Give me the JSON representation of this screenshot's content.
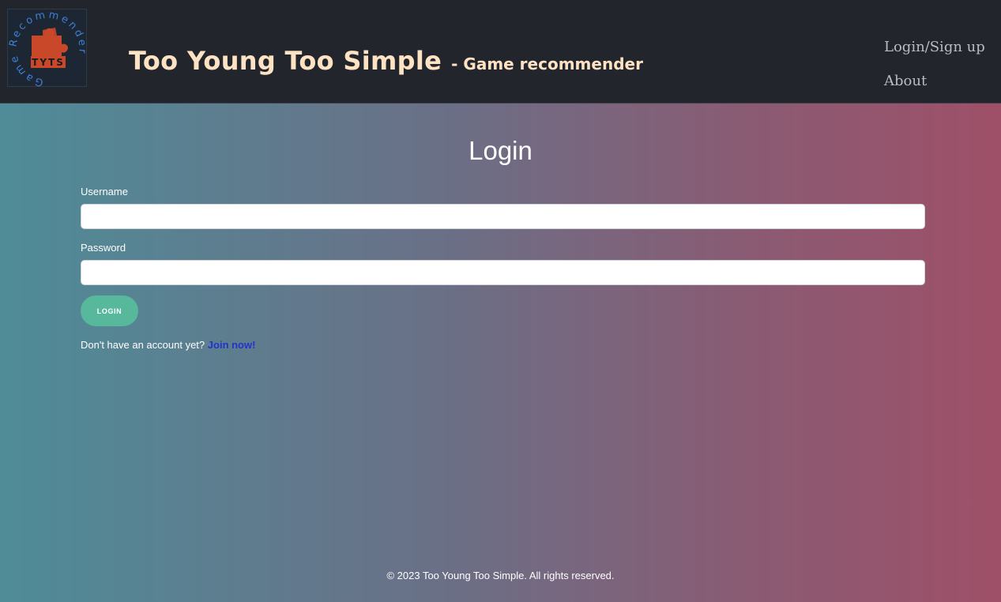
{
  "header": {
    "logo": {
      "ring_text": "Game Recommender",
      "badge_text": "TYTS",
      "icon": "puzzle-piece-icon",
      "ring_color": "#3d7fd6",
      "puzzle_color": "#c9482a"
    },
    "title": "Too Young Too Simple",
    "subtitle": "- Game recommender",
    "nav": {
      "login_signup": "Login/Sign up",
      "about": "About"
    }
  },
  "form": {
    "title": "Login",
    "username_label": "Username",
    "username_value": "",
    "password_label": "Password",
    "password_value": "",
    "login_button": "LOGIN",
    "signup_prompt": "Don't have an account yet?",
    "signup_link": "Join now!"
  },
  "footer": {
    "copyright": "© 2023 Too Young Too Simple. All rights reserved."
  },
  "colors": {
    "navbar_bg": "#22252b",
    "brand_text": "#fde3c4",
    "gradient_left": "#4f8c98",
    "gradient_right": "#9e5068",
    "button_bg": "#57b89b",
    "link": "#2233cc"
  }
}
